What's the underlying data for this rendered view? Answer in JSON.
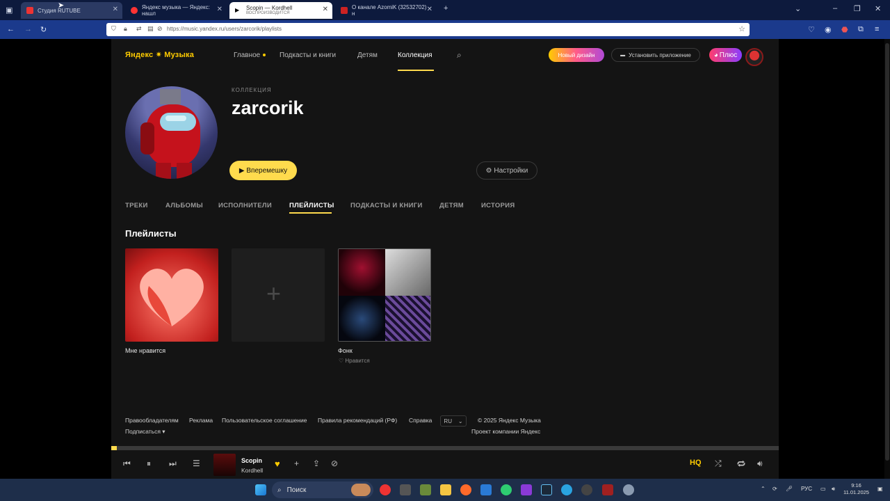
{
  "browser": {
    "tabs": [
      {
        "title": "Студия RUTUBE",
        "active": false
      },
      {
        "title": "Яндекс музыка — Яндекс: нашл",
        "active": false
      },
      {
        "title": "Scopin — Kordhell",
        "subtitle": "ВОСПРОИЗВОДИТСЯ",
        "active": true
      },
      {
        "title": "О канале AzomiK (32532702) н",
        "active": false
      }
    ],
    "new_tab": "+",
    "url": "https://music.yandex.ru/users/zarcorik/playlists"
  },
  "header": {
    "logo": "Яндекс ✷ Музыка",
    "nav": [
      {
        "label": "Главное"
      },
      {
        "label": "Подкасты и книги"
      },
      {
        "label": "Детям"
      },
      {
        "label": "Коллекция"
      }
    ],
    "new_design": "Новый дизайн",
    "install_app": "Установить приложение",
    "plus": "Плюс"
  },
  "profile": {
    "caption": "КОЛЛЕКЦИЯ",
    "name": "zarcorik",
    "shuffle": "▶ Вперемешку",
    "settings": "⚙ Настройки"
  },
  "subtabs": [
    "ТРЕКИ",
    "АЛЬБОМЫ",
    "ИСПОЛНИТЕЛИ",
    "ПЛЕЙЛИСТЫ",
    "ПОДКАСТЫ И КНИГИ",
    "ДЕТЯМ",
    "ИСТОРИЯ"
  ],
  "playlists": {
    "title": "Плейлисты",
    "items": [
      {
        "name": "Мне нравится",
        "sub": ""
      },
      {
        "name": "",
        "sub": ""
      },
      {
        "name": "Фонк",
        "sub": "♡ Нравится"
      }
    ]
  },
  "footer": {
    "links": [
      "Правообладателям",
      "Реклама",
      "Пользовательское соглашение",
      "Правила рекомендаций (РФ)",
      "Справка"
    ],
    "subscribe": "Подписаться ▾",
    "lang": "RU",
    "copyright": "© 2025 Яндекс Музыка",
    "project": "Проект компании Яндекс"
  },
  "player": {
    "track": "Scopin",
    "artist": "Kordhell",
    "quality": "HQ",
    "progress": 0.008
  },
  "taskbar": {
    "search": "Поиск",
    "lang": "РУС",
    "time": "9:16",
    "date": "11.01.2025"
  }
}
